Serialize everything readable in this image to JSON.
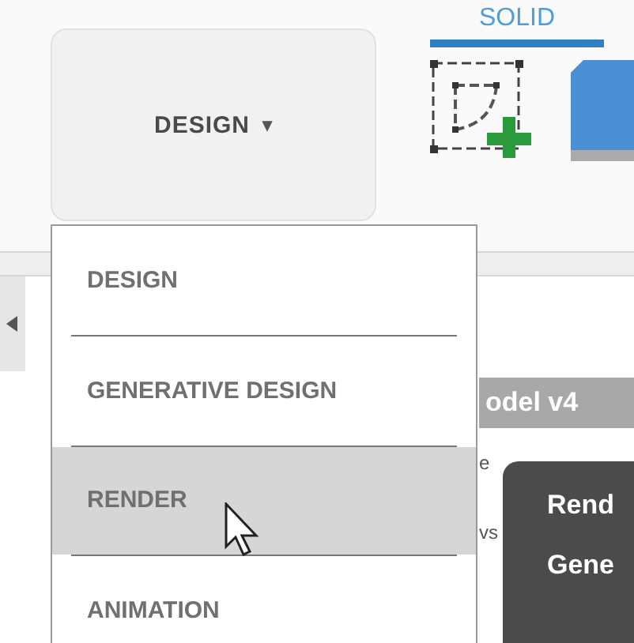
{
  "workspace_button": {
    "label": "DESIGN",
    "caret": "▾"
  },
  "toolbar_tab": {
    "label": "SOLID",
    "selected": true
  },
  "workspace_menu": {
    "items": [
      {
        "label": "DESIGN",
        "selected": false
      },
      {
        "label": "GENERATIVE DESIGN",
        "selected": false
      },
      {
        "label": "RENDER",
        "selected": true
      },
      {
        "label": "ANIMATION",
        "selected": false
      }
    ]
  },
  "browser": {
    "title": "odel v4",
    "rows": [
      "e",
      "vs"
    ]
  },
  "tooltip": {
    "lines": [
      "Rend",
      "Gene"
    ]
  }
}
